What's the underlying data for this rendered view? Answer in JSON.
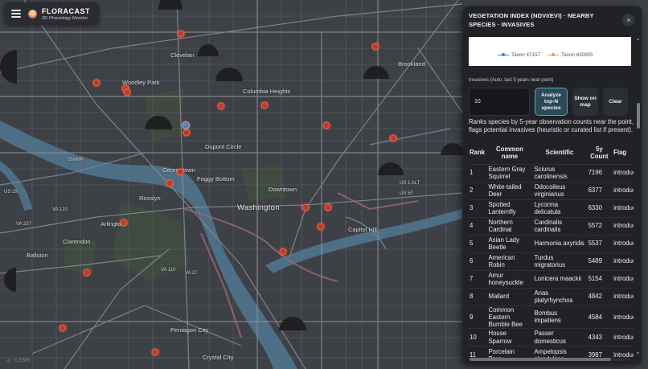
{
  "app": {
    "name": "FLORACAST",
    "subtitle": "3D Phenology Monitor"
  },
  "map": {
    "attribution": "© ESRI",
    "labels": {
      "cleveland": "Clevelan",
      "brookland": "Brookland",
      "woodley_park": "Woodley Park",
      "columbia_heights": "Columbia Heights",
      "dupont_circle": "Dupont Circle",
      "georgetown": "Georgetown",
      "foggy_bottom": "Foggy Bottom",
      "downtown": "Downtown",
      "washington": "Washington",
      "capitol_hill": "Capitol Hill",
      "rosslyn": "Rosslyn",
      "arlington": "Arlington",
      "clarendon": "Clarendon",
      "ballston": "Ballston",
      "pentagon_city": "Pentagon City",
      "crystal_city": "Crystal City",
      "bwmp": "BWMP",
      "us29": "US 29",
      "va237": "VA 237",
      "va120": "VA 120",
      "va27": "VA 27",
      "us50": "US 50",
      "us1alt": "US 1 ALT",
      "va110": "VA 110"
    }
  },
  "panel": {
    "title": "VEGETATION INDEX (NDVI/EVI) · NEARBY SPECIES · INVASIVES",
    "close_label": "×",
    "legend": [
      {
        "name": "Taxon 47157",
        "color": "#4a7fa7"
      },
      {
        "name": "Taxon 630955",
        "color": "#e39a52"
      }
    ],
    "invasives_title": "Invasives (Auto, last 5 years near point)",
    "topn_value": "10",
    "buttons": {
      "analyze": "Analyze top-N species",
      "show_on_map": "Show on map",
      "clear": "Clear"
    },
    "description": "Ranks species by 5-year observation counts near the point, flags potential invasives (heuristic or curated list if present).",
    "table": {
      "headers": [
        "Rank",
        "Common name",
        "Scientific",
        "5y Count",
        "Flag"
      ],
      "rows": [
        {
          "rank": "1",
          "common": "Eastern Gray Squirrel",
          "scientific": "Sciurus carolinensis",
          "count": "7196",
          "flag": "introduced"
        },
        {
          "rank": "2",
          "common": "White-tailed Deer",
          "scientific": "Odocoileus virginianus",
          "count": "6377",
          "flag": "introduced"
        },
        {
          "rank": "3",
          "common": "Spotted Lanternfly",
          "scientific": "Lycorma delicatula",
          "count": "6330",
          "flag": "introduced"
        },
        {
          "rank": "4",
          "common": "Northern Cardinal",
          "scientific": "Cardinalis cardinalis",
          "count": "5572",
          "flag": "introduced"
        },
        {
          "rank": "5",
          "common": "Asian Lady Beetle",
          "scientific": "Harmonia axyridis",
          "count": "5537",
          "flag": "introduced"
        },
        {
          "rank": "6",
          "common": "American Robin",
          "scientific": "Turdus migratorius",
          "count": "5489",
          "flag": "introduced"
        },
        {
          "rank": "7",
          "common": "Amur honeysuckle",
          "scientific": "Lonicera maackii",
          "count": "5154",
          "flag": "introduced"
        },
        {
          "rank": "8",
          "common": "Mallard",
          "scientific": "Anas platyrhynchos",
          "count": "4842",
          "flag": "introduced"
        },
        {
          "rank": "9",
          "common": "Common Eastern Bumble Bee",
          "scientific": "Bombus impatiens",
          "count": "4584",
          "flag": "introduced"
        },
        {
          "rank": "10",
          "common": "House Sparrow",
          "scientific": "Passer domesticus",
          "count": "4343",
          "flag": "introduced"
        },
        {
          "rank": "11",
          "common": "Porcelain Berry",
          "scientific": "Ampelopsis glandulosa",
          "count": "3987",
          "flag": "introduced"
        }
      ]
    }
  }
}
